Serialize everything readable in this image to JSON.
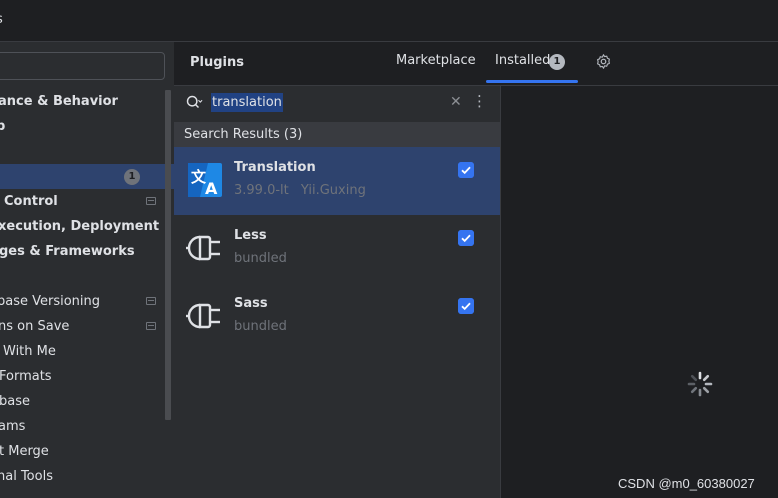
{
  "window": {
    "title_fragment": "s"
  },
  "sidebar": {
    "items": [
      {
        "label": "ance & Behavior",
        "bold": true
      },
      {
        "label": "p",
        "bold": true
      },
      {
        "label": "",
        "bold": false
      },
      {
        "label": "",
        "bold": false,
        "count": "1",
        "selected": true
      },
      {
        "label": "Control",
        "bold": true,
        "project": true
      },
      {
        "label": "xecution, Deployment",
        "bold": true
      },
      {
        "label": "ges & Frameworks",
        "bold": true
      },
      {
        "label": "",
        "bold": false
      },
      {
        "label": "base Versioning",
        "bold": false,
        "project": true
      },
      {
        "label": "ns on Save",
        "bold": false,
        "project": true
      },
      {
        "label": "With Me",
        "bold": false
      },
      {
        "label": "Formats",
        "bold": false
      },
      {
        "label": "base",
        "bold": false
      },
      {
        "label": "ams",
        "bold": false
      },
      {
        "label": "t Merge",
        "bold": false
      },
      {
        "label": "nal Tools",
        "bold": false
      }
    ]
  },
  "plugins": {
    "title": "Plugins",
    "tabs": [
      {
        "label": "Marketplace",
        "active": false
      },
      {
        "label": "Installed",
        "active": true,
        "badge": "1"
      }
    ],
    "search": {
      "value": "translation"
    },
    "results_header": "Search Results (3)",
    "results": [
      {
        "name": "Translation",
        "version": "3.99.0-lt",
        "vendor": "Yii.Guxing",
        "enabled": true,
        "selected": true,
        "icon": "translate-icon"
      },
      {
        "name": "Less",
        "version": "bundled",
        "vendor": "",
        "enabled": true,
        "selected": false,
        "icon": "plug-icon"
      },
      {
        "name": "Sass",
        "version": "bundled",
        "vendor": "",
        "enabled": true,
        "selected": false,
        "icon": "plug-icon"
      }
    ]
  },
  "details": {
    "state": "loading"
  },
  "watermark": "CSDN @m0_60380027",
  "colors": {
    "accent": "#3574f0",
    "selection": "#2e436e",
    "background": "#1e1f22",
    "panel": "#2b2d30"
  }
}
